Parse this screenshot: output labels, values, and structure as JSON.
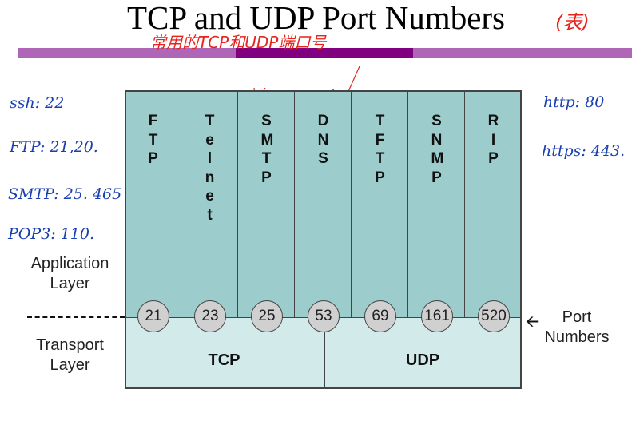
{
  "title": "TCP and UDP Port Numbers",
  "annotations": {
    "title_note": "(表)",
    "subtitle_note": "常用的TCP和UDP端口号",
    "left_notes": [
      "ssh: 22",
      "FTP: 21,20.",
      "SMTP: 25. 465",
      "POP3: 110."
    ],
    "right_notes": [
      "http: 80",
      "https: 443."
    ]
  },
  "diagram": {
    "protocols": [
      {
        "name": "FTP",
        "port": "21"
      },
      {
        "name": "Telnet",
        "port": "23"
      },
      {
        "name": "SMTP",
        "port": "25"
      },
      {
        "name": "DNS",
        "port": "53"
      },
      {
        "name": "TFTP",
        "port": "69"
      },
      {
        "name": "SNMP",
        "port": "161"
      },
      {
        "name": "RIP",
        "port": "520"
      }
    ],
    "application_layer": "Application\nLayer",
    "transport_layer": "Transport\nLayer",
    "port_numbers_label": "Port\nNumbers",
    "tcp": "TCP",
    "udp": "UDP"
  },
  "colors": {
    "bar": "#b066b6",
    "bar_dark": "#800080",
    "app": "#9ccccc",
    "transport": "#d3eaea"
  }
}
